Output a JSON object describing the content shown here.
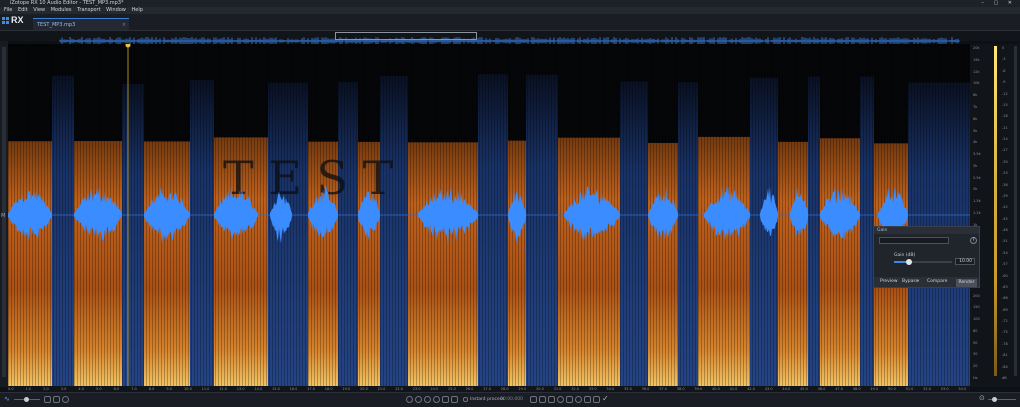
{
  "window": {
    "title": "iZotope RX 10 Audio Editor - TEST_MP3.mp3*",
    "controls": [
      "–",
      "▢",
      "✕"
    ]
  },
  "menu": [
    "File",
    "Edit",
    "View",
    "Modules",
    "Transport",
    "Window",
    "Help"
  ],
  "app": {
    "logo_text": "RX",
    "file_tab": "TEST_MP3.mp3",
    "file_tab_close": "×"
  },
  "editor": {
    "channel_label": "M",
    "watermark": "T  E  S  T",
    "time_ticks": [
      "0.0",
      "1.0",
      "2.0",
      "3.0",
      "4.0",
      "5.0",
      "6.0",
      "7.0",
      "8.0",
      "9.0",
      "10.0",
      "11.0",
      "12.0",
      "13.0",
      "14.0",
      "15.0",
      "16.0",
      "17.0",
      "18.0",
      "19.0",
      "20.0",
      "21.0",
      "22.0",
      "23.0",
      "24.0",
      "25.0",
      "26.0",
      "27.0",
      "28.0",
      "29.0",
      "30.0",
      "31.0",
      "32.0",
      "33.0",
      "34.0",
      "35.0",
      "36.0",
      "37.0",
      "38.0",
      "39.0",
      "40.0",
      "41.0",
      "42.0",
      "43.0",
      "44.0",
      "45.0",
      "46.0",
      "47.0",
      "48.0",
      "49.0",
      "50.0",
      "51.0",
      "52.0",
      "53.0",
      "54.0"
    ],
    "time_unit": "sec",
    "freq_scale": [
      "20k",
      "15k",
      "12k",
      "10k",
      "8k",
      "7k",
      "6k",
      "5k",
      "4k",
      "3.5k",
      "3k",
      "2.5k",
      "2k",
      "1.5k",
      "1.2k",
      "1k",
      "800",
      "600",
      "500",
      "400",
      "300",
      "200",
      "150",
      "100",
      "80",
      "50",
      "30",
      "20",
      "Hz"
    ],
    "db_scale": [
      "0",
      "-3",
      "-6",
      "-9",
      "-12",
      "-15",
      "-18",
      "-21",
      "-24",
      "-27",
      "-30",
      "-33",
      "-36",
      "-39",
      "-42",
      "-45",
      "-48",
      "-51",
      "-54",
      "-57",
      "-60",
      "-63",
      "-66",
      "-69",
      "-72",
      "-75",
      "-78",
      "-81",
      "-84",
      "dB"
    ],
    "colors": {
      "waveform": "#3a8cff",
      "spectrogram_hot": "#f08a2a",
      "spectrogram_cool": "#1c3a78"
    }
  },
  "gain_panel": {
    "title": "Gain",
    "preset": "",
    "help": "?",
    "label": "Gain (dB)",
    "value": "10.00",
    "slider_fraction": 0.25,
    "buttons": {
      "preview": "Preview",
      "bypass": "Bypass",
      "compare": "Compare",
      "render": "Render"
    }
  },
  "transport": {
    "instant_process_label": "Instant process",
    "time_display": "00:00.000"
  }
}
